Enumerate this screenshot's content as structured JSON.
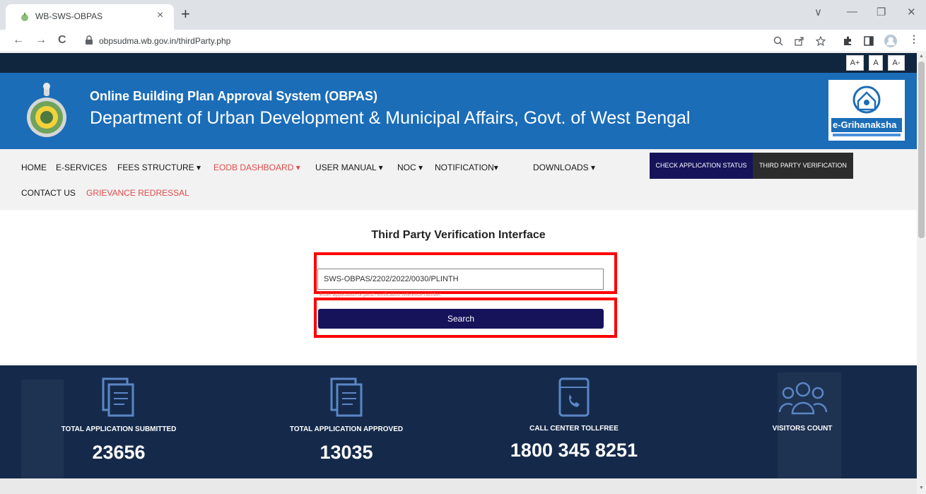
{
  "browser": {
    "tab_title": "WB-SWS-OBPAS",
    "tab_close": "×",
    "new_tab": "+",
    "url": "obpsudma.wb.gov.in/thirdParty.php",
    "back": "←",
    "forward": "→",
    "reload": "C",
    "min": "—",
    "max": "❐",
    "close": "✕",
    "dropdown": "∨"
  },
  "accessibility": {
    "increase": "A+",
    "normal": "A",
    "decrease": "A-"
  },
  "header": {
    "title": "Online Building Plan Approval System (OBPAS)",
    "subtitle": "Department of Urban Development & Municipal Affairs, Govt. of West Bengal",
    "logo_text": "e-Grihanaksha"
  },
  "nav": {
    "home": "HOME",
    "eservices": "E-SERVICES",
    "fees": "FEES STRUCTURE ▾",
    "eodb": "EODB DASHBOARD ▾",
    "manual": "USER MANUAL ▾",
    "noc": "NOC ▾",
    "notification": "NOTIFICATION▾",
    "downloads": "DOWNLOADS ▾",
    "contact": "CONTACT US",
    "grievance": "GRIEVANCE REDRESSAL",
    "check_status": "CHECK APPLICATION STATUS",
    "third_party": "THIRD PARTY VERIFICATION"
  },
  "form": {
    "title": "Third Party Verification Interface",
    "input_value": "SWS-OBPAS/2202/2022/0030/PLINTH",
    "helper": "Enter application or plinth verification reference number",
    "search_label": "Search"
  },
  "stats": {
    "submitted_label": "TOTAL APPLICATION SUBMITTED",
    "submitted_value": "23656",
    "approved_label": "TOTAL APPLICATION APPROVED",
    "approved_value": "13035",
    "callcenter_label": "CALL CENTER TOLLFREE",
    "callcenter_value": "1800 345 8251",
    "visitors_label": "VISITORS COUNT"
  },
  "colors": {
    "banner": "#1b6db8",
    "dark_navy": "#16135b",
    "stats_bg": "#152a4b",
    "accent_red": "#e14b4b",
    "highlight": "#ff0000"
  }
}
